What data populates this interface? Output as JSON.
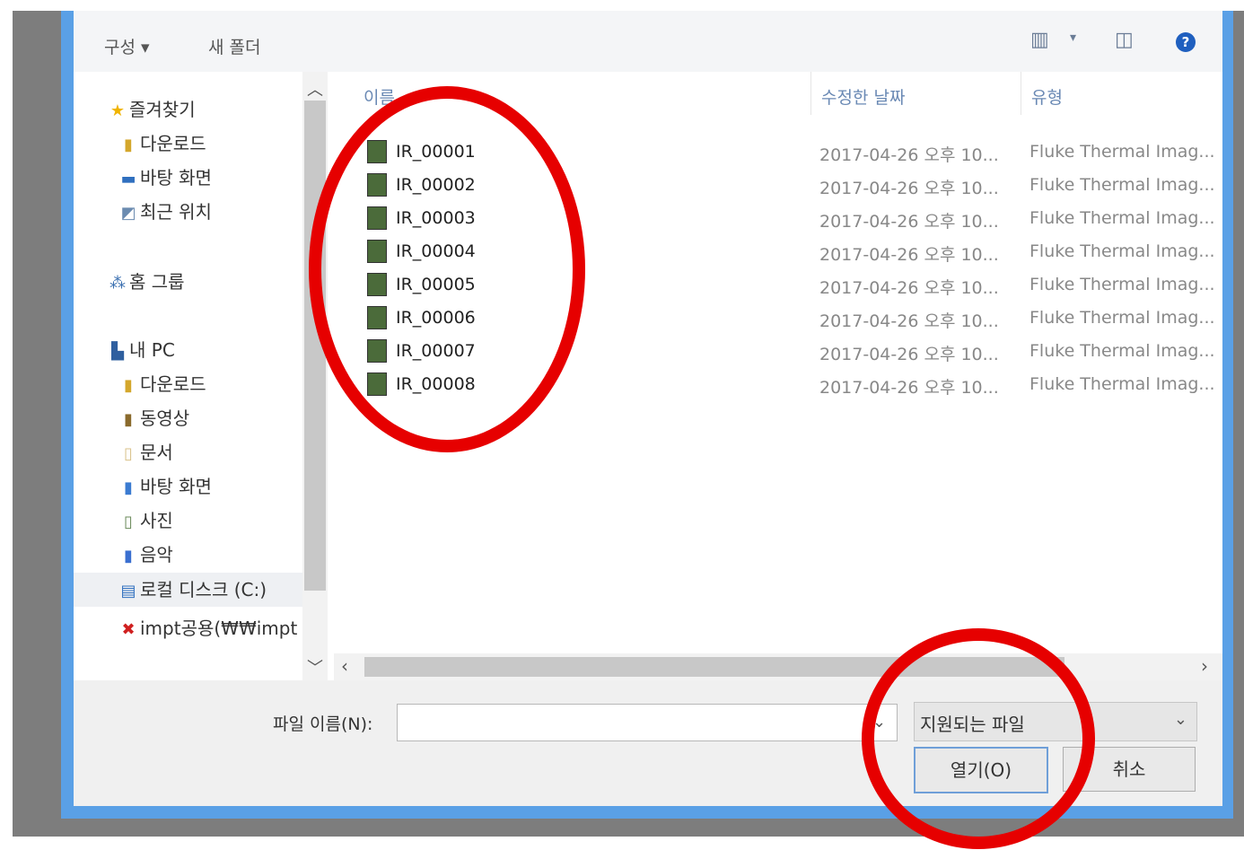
{
  "toolbar": {
    "organize": "구성 ▾",
    "new_folder": "새 폴더"
  },
  "nav": {
    "items": [
      {
        "label": "즐겨찾기",
        "icon": "star-icon"
      },
      {
        "label": "다운로드",
        "icon": "download-folder-icon"
      },
      {
        "label": "바탕 화면",
        "icon": "desktop-icon"
      },
      {
        "label": "최근 위치",
        "icon": "recent-places-icon"
      },
      {
        "label": "홈 그룹",
        "icon": "homegroup-icon"
      },
      {
        "label": "내 PC",
        "icon": "pc-icon"
      },
      {
        "label": "다운로드",
        "icon": "download-folder-icon"
      },
      {
        "label": "동영상",
        "icon": "videos-folder-icon"
      },
      {
        "label": "문서",
        "icon": "documents-folder-icon"
      },
      {
        "label": "바탕 화면",
        "icon": "desktop-folder-icon"
      },
      {
        "label": "사진",
        "icon": "pictures-folder-icon"
      },
      {
        "label": "음악",
        "icon": "music-folder-icon"
      },
      {
        "label": "로컬 디스크 (C:)",
        "icon": "local-disk-icon"
      },
      {
        "label": "impt공용(₩₩impt",
        "icon": "network-drive-icon"
      }
    ]
  },
  "list": {
    "headers": {
      "name": "이름",
      "date": "수정한 날짜",
      "type": "유형"
    },
    "files": [
      {
        "name": "IR_00001",
        "date": "2017-04-26 오후 10...",
        "type": "Fluke Thermal Imag..."
      },
      {
        "name": "IR_00002",
        "date": "2017-04-26 오후 10...",
        "type": "Fluke Thermal Imag..."
      },
      {
        "name": "IR_00003",
        "date": "2017-04-26 오후 10...",
        "type": "Fluke Thermal Imag..."
      },
      {
        "name": "IR_00004",
        "date": "2017-04-26 오후 10...",
        "type": "Fluke Thermal Imag..."
      },
      {
        "name": "IR_00005",
        "date": "2017-04-26 오후 10...",
        "type": "Fluke Thermal Imag..."
      },
      {
        "name": "IR_00006",
        "date": "2017-04-26 오후 10...",
        "type": "Fluke Thermal Imag..."
      },
      {
        "name": "IR_00007",
        "date": "2017-04-26 오후 10...",
        "type": "Fluke Thermal Imag..."
      },
      {
        "name": "IR_00008",
        "date": "2017-04-26 오후 10...",
        "type": "Fluke Thermal Imag..."
      }
    ]
  },
  "bottom": {
    "filename_label": "파일 이름(N):",
    "filename_value": "",
    "file_type_filter": "지원되는 파일",
    "open_label": "열기(O)",
    "cancel_label": "취소"
  },
  "colors": {
    "annotation": "#e60000",
    "frame": "#5aa0e6"
  }
}
